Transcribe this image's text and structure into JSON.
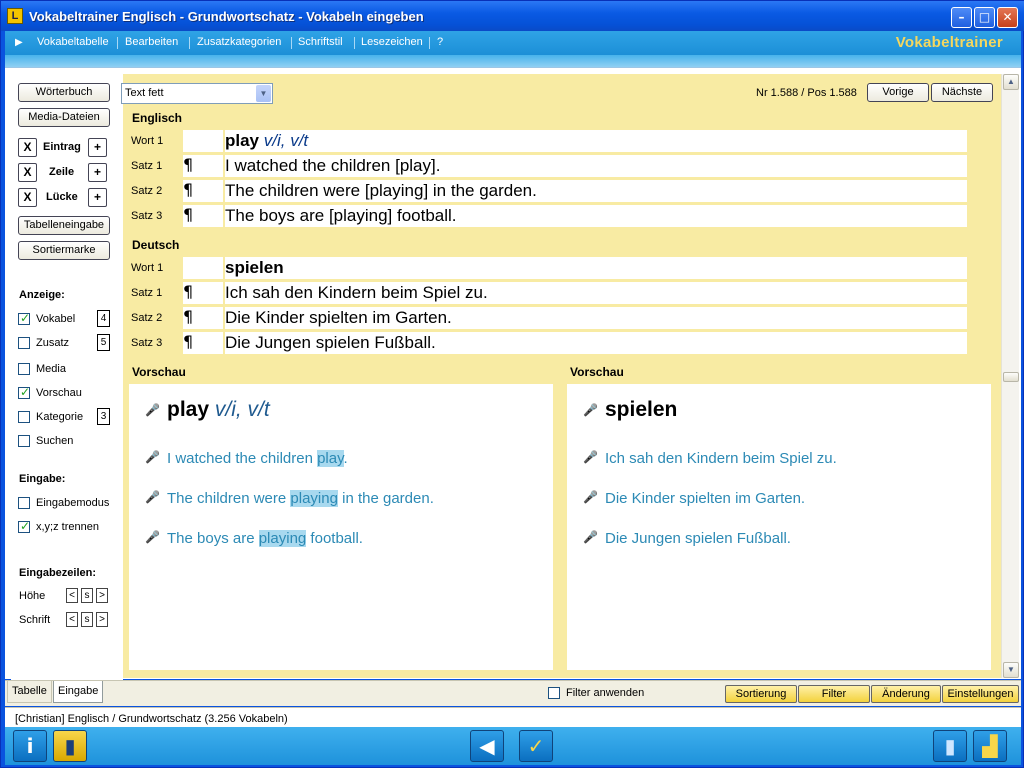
{
  "window": {
    "title": "Vokabeltrainer Englisch - Grundwortschatz - Vokabeln eingeben",
    "app_icon": "L"
  },
  "menu": {
    "items": [
      "Vokabeltabelle",
      "Bearbeiten",
      "Zusatzkategorien",
      "Schriftstil",
      "Lesezeichen",
      "?"
    ],
    "brand": "Vokabeltrainer"
  },
  "left": {
    "woerterbuch": "Wörterbuch",
    "media_dateien": "Media-Dateien",
    "eintrag": "Eintrag",
    "zeile": "Zeile",
    "luecke": "Lücke",
    "x_label": "X",
    "plus_label": "+",
    "tabelleneingabe": "Tabelleneingabe",
    "sortiermarke": "Sortiermarke",
    "anzeige_header": "Anzeige:",
    "anzeige": [
      {
        "label": "Vokabel",
        "checked": true,
        "num": "4"
      },
      {
        "label": "Zusatz",
        "checked": false,
        "num": "5"
      },
      {
        "label": "Media",
        "checked": false,
        "num": ""
      },
      {
        "label": "Vorschau",
        "checked": true,
        "num": ""
      },
      {
        "label": "Kategorie",
        "checked": false,
        "num": "3"
      },
      {
        "label": "Suchen",
        "checked": false,
        "num": ""
      }
    ],
    "eingabe_header": "Eingabe:",
    "eingabe": [
      {
        "label": "Eingabemodus",
        "checked": false
      },
      {
        "label": "x,y;z trennen",
        "checked": true
      }
    ],
    "eingabezeilen_header": "Eingabezeilen:",
    "hoehe": "Höhe",
    "schrift": "Schrift",
    "step_lt": "<",
    "step_s": "s",
    "step_gt": ">"
  },
  "toolbar": {
    "style_select": "Text fett",
    "position": "Nr 1.588 / Pos 1.588",
    "vorige": "Vorige",
    "naechste": "Nächste"
  },
  "englisch": {
    "header": "Englisch",
    "wort_label": "Wort 1",
    "wort": "play",
    "wort_type": "v/i, v/t",
    "saetze": [
      {
        "label": "Satz 1",
        "mark": "¶",
        "text": "I watched the children [play]."
      },
      {
        "label": "Satz 2",
        "mark": "¶",
        "text": "The children were [playing] in the garden."
      },
      {
        "label": "Satz 3",
        "mark": "¶",
        "text": "The boys are [playing] football."
      }
    ]
  },
  "deutsch": {
    "header": "Deutsch",
    "wort_label": "Wort 1",
    "wort": "spielen",
    "saetze": [
      {
        "label": "Satz 1",
        "mark": "¶",
        "text": "Ich sah den Kindern beim Spiel zu."
      },
      {
        "label": "Satz 2",
        "mark": "¶",
        "text": "Die Kinder spielten im Garten."
      },
      {
        "label": "Satz 3",
        "mark": "¶",
        "text": "Die Jungen spielen Fußball."
      }
    ]
  },
  "preview_en": {
    "header": "Vorschau",
    "wort": "play",
    "wort_type": "v/i, v/t",
    "lines": [
      {
        "pre": "I watched the children ",
        "hl": "play",
        "post": "."
      },
      {
        "pre": "The children were ",
        "hl": "playing",
        "post": " in the garden."
      },
      {
        "pre": "The boys are ",
        "hl": "playing",
        "post": " football."
      }
    ]
  },
  "preview_de": {
    "header": "Vorschau",
    "wort": "spielen",
    "lines": [
      "Ich sah den Kindern beim Spiel zu.",
      "Die Kinder spielten im Garten.",
      "Die Jungen spielen Fußball."
    ]
  },
  "bottom": {
    "tab_tabelle": "Tabelle",
    "tab_eingabe": "Eingabe",
    "filter_anwenden": "Filter anwenden",
    "sortierung": "Sortierung",
    "filter": "Filter",
    "aenderung": "Änderung",
    "einstellungen": "Einstellungen",
    "status": "[Christian]  Englisch / Grundwortschatz  (3.256 Vokabeln)"
  },
  "icons": {
    "mic": "microphone-speaker-icon",
    "info": "info-icon",
    "book": "book-icon",
    "back": "back-arrow-icon",
    "check": "check-icon",
    "exit": "exit-book-icon",
    "stats": "stats-icon"
  },
  "colors": {
    "title": "#0a5ae4",
    "menu": "#1c8fd7",
    "content_bg": "#f8eba3",
    "preview_text": "#2c8ab5",
    "highlight": "#a8d9ef",
    "brand": "#f5d75e"
  }
}
